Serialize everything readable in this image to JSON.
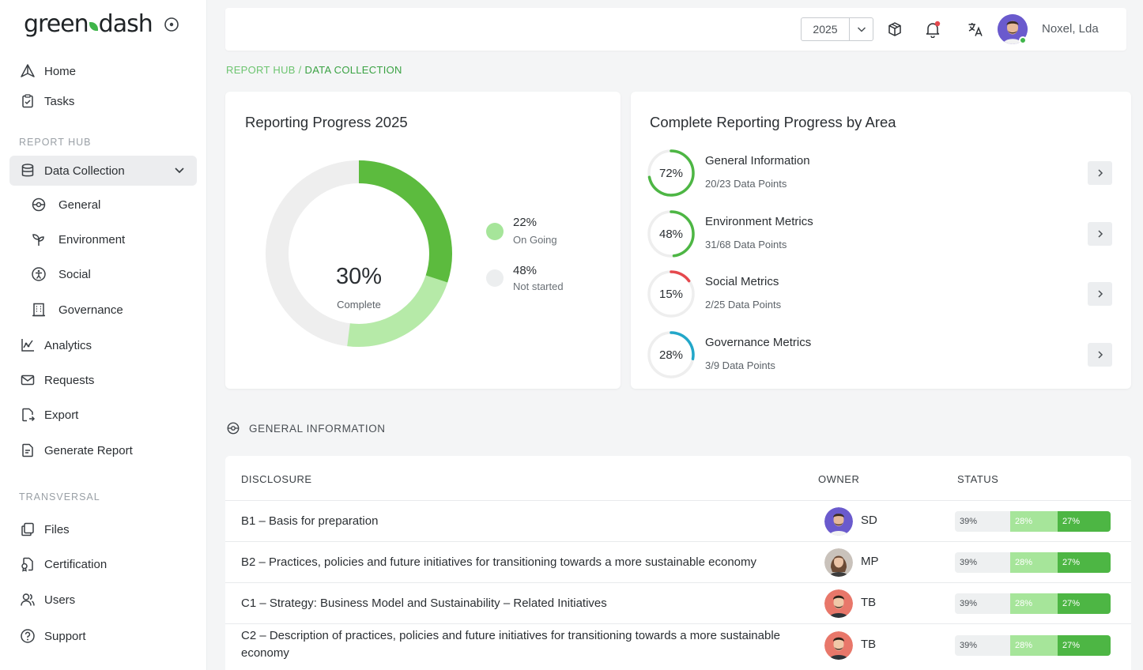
{
  "app": {
    "logo_text_left": "green",
    "logo_text_right": "dash"
  },
  "sidebar": {
    "top_items": [
      {
        "label": "Home",
        "icon": "home-icon"
      },
      {
        "label": "Tasks",
        "icon": "tasks-icon"
      }
    ],
    "report_hub_label": "REPORT HUB",
    "data_collection": {
      "label": "Data Collection",
      "icon": "database-icon",
      "expanded": true
    },
    "sub_items": [
      {
        "label": "General",
        "icon": "target-icon"
      },
      {
        "label": "Environment",
        "icon": "sprout-icon"
      },
      {
        "label": "Social",
        "icon": "accessibility-icon"
      },
      {
        "label": "Governance",
        "icon": "building-icon"
      }
    ],
    "hub_items": [
      {
        "label": "Analytics",
        "icon": "analytics-icon"
      },
      {
        "label": "Requests",
        "icon": "mail-icon"
      },
      {
        "label": "Export",
        "icon": "export-icon"
      },
      {
        "label": "Generate Report",
        "icon": "report-icon"
      }
    ],
    "transversal_label": "TRANSVERSAL",
    "transversal_items": [
      {
        "label": "Files",
        "icon": "files-icon"
      },
      {
        "label": "Certification",
        "icon": "certificate-icon"
      },
      {
        "label": "Users",
        "icon": "users-icon"
      },
      {
        "label": "Support",
        "icon": "help-icon"
      }
    ]
  },
  "header": {
    "year": "2025",
    "user_name": "Noxel, Lda",
    "notification_dot_color": "#e5484d"
  },
  "breadcrumb": {
    "root": "REPORT HUB",
    "separator": " / ",
    "current": "DATA COLLECTION"
  },
  "progress_card": {
    "title": "Reporting Progress 2025",
    "center_value": "30%",
    "center_label": "Complete",
    "complete_fraction": 0.3,
    "ongoing_fraction": 0.22,
    "legend": [
      {
        "pct": "22%",
        "label": "On Going",
        "color": "#a6e59a"
      },
      {
        "pct": "48%",
        "label": "Not started",
        "color": "#eceeef"
      }
    ],
    "colors": {
      "complete": "#5cbb3e",
      "ongoing": "#b6eaa8",
      "not_started": "#eeeeee"
    }
  },
  "area_card": {
    "title": "Complete Reporting Progress by Area",
    "areas": [
      {
        "pct_label": "72%",
        "fraction": 0.72,
        "name": "General Information",
        "points": "20/23 Data Points",
        "color": "#4db644"
      },
      {
        "pct_label": "48%",
        "fraction": 0.48,
        "name": "Environment Metrics",
        "points": "31/68 Data Points",
        "color": "#4db644"
      },
      {
        "pct_label": "15%",
        "fraction": 0.15,
        "name": "Social Metrics",
        "points": "2/25 Data Points",
        "color": "#e5484d"
      },
      {
        "pct_label": "28%",
        "fraction": 0.28,
        "name": "Governance Metrics",
        "points": "3/9 Data Points",
        "color": "#22a7c9"
      }
    ]
  },
  "general_section": {
    "title": "GENERAL INFORMATION"
  },
  "table": {
    "headers": {
      "disclosure": "DISCLOSURE",
      "owner": "OWNER",
      "status": "STATUS"
    },
    "rows": [
      {
        "disclosure": "B1 – Basis for preparation",
        "owner": "SD",
        "avatar_color": "#6a5acd",
        "s1": "39%",
        "s2": "28%",
        "s3": "27%"
      },
      {
        "disclosure": "B2 – Practices, policies and future initiatives for transitioning towards a more sustainable economy",
        "owner": "MP",
        "avatar_color": "#b8b0a8",
        "s1": "39%",
        "s2": "28%",
        "s3": "27%"
      },
      {
        "disclosure": "C1 – Strategy: Business Model and Sustainability – Related Initiatives",
        "owner": "TB",
        "avatar_color": "#e8776a",
        "s1": "39%",
        "s2": "28%",
        "s3": "27%"
      },
      {
        "disclosure": "C2 – Description of practices, policies and future initiatives for transitioning towards a more sustainable economy",
        "owner": "TB",
        "avatar_color": "#e8776a",
        "s1": "39%",
        "s2": "28%",
        "s3": "27%"
      }
    ]
  }
}
